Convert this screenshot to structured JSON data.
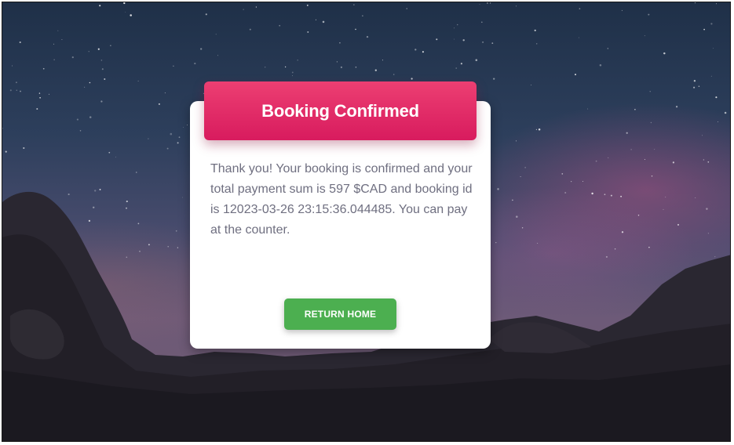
{
  "card": {
    "title": "Booking Confirmed",
    "message": "Thank you! Your booking is confirmed and your total payment sum is 597 $CAD and booking id is 12023-03-26 23:15:36.044485. You can pay at the counter.",
    "button_label": "RETURN HOME"
  },
  "colors": {
    "header_accent": "#e0286a",
    "button_green": "#4caf50",
    "body_text": "#6f6f80"
  }
}
